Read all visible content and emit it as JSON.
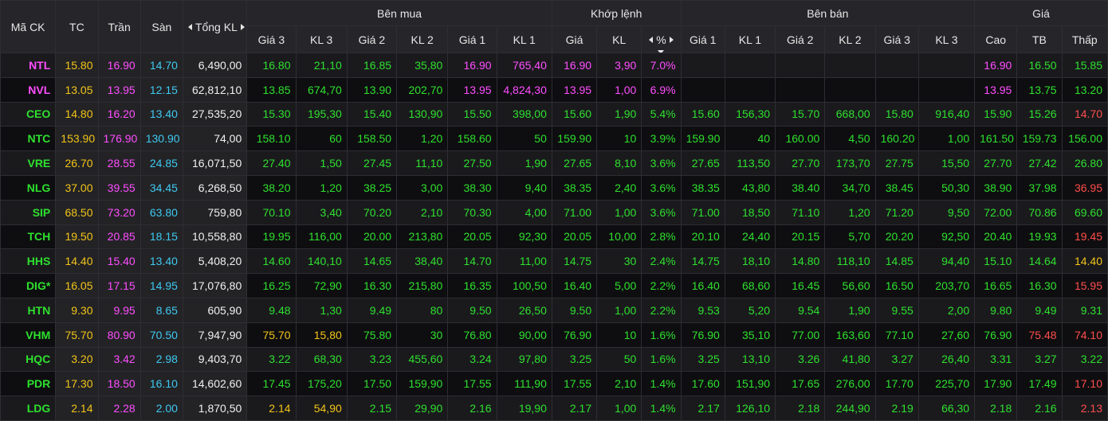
{
  "header": {
    "symbol": "Mã CK",
    "ref": "TC",
    "ceil": "Trần",
    "floor": "Sàn",
    "total_vol": "Tổng KL",
    "buy_group": "Bên mua",
    "match_group": "Khớp lệnh",
    "sell_group": "Bên bán",
    "price_group": "Giá",
    "buy_cols": [
      "Giá 3",
      "KL 3",
      "Giá 2",
      "KL 2",
      "Giá 1",
      "KL 1"
    ],
    "match_cols": [
      "Giá",
      "KL",
      "%"
    ],
    "sell_cols": [
      "Giá 1",
      "KL 1",
      "Giá 2",
      "KL 2",
      "Giá 3",
      "KL 3"
    ],
    "price_cols": [
      "Cao",
      "TB",
      "Thấp"
    ]
  },
  "colors": {
    "ceil": "#ff4dff",
    "floor": "#3fc9f0",
    "ref": "#f2c418",
    "up": "#2ee02e",
    "down": "#ff4d4d"
  },
  "rows": [
    {
      "sym": "NTL",
      "sc": "ceil",
      "tc": "15.80",
      "ceil": "16.90",
      "floor": "14.70",
      "tot": "6,490,00",
      "b": [
        [
          "16.80",
          "up"
        ],
        [
          "21,10",
          "up"
        ],
        [
          "16.85",
          "up"
        ],
        [
          "35,80",
          "up"
        ],
        [
          "16.90",
          "ceil"
        ],
        [
          "765,40",
          "ceil"
        ]
      ],
      "m": [
        [
          "16.90",
          "ceil"
        ],
        [
          "3,90",
          "ceil"
        ],
        [
          "7.0%",
          "ceil"
        ]
      ],
      "s": [
        [
          "",
          ""
        ],
        [
          "",
          ""
        ],
        [
          "",
          ""
        ],
        [
          "",
          ""
        ],
        [
          "",
          ""
        ],
        [
          "",
          ""
        ]
      ],
      "p": [
        [
          "16.90",
          "ceil"
        ],
        [
          "16.50",
          "up"
        ],
        [
          "15.85",
          "up"
        ]
      ]
    },
    {
      "sym": "NVL",
      "sc": "ceil",
      "tc": "13.05",
      "ceil": "13.95",
      "floor": "12.15",
      "tot": "62,812,10",
      "b": [
        [
          "13.85",
          "up"
        ],
        [
          "674,70",
          "up"
        ],
        [
          "13.90",
          "up"
        ],
        [
          "202,70",
          "up"
        ],
        [
          "13.95",
          "ceil"
        ],
        [
          "4,824,30",
          "ceil"
        ]
      ],
      "m": [
        [
          "13.95",
          "ceil"
        ],
        [
          "1,00",
          "ceil"
        ],
        [
          "6.9%",
          "ceil"
        ]
      ],
      "s": [
        [
          "",
          ""
        ],
        [
          "",
          ""
        ],
        [
          "",
          ""
        ],
        [
          "",
          ""
        ],
        [
          "",
          ""
        ],
        [
          "",
          ""
        ]
      ],
      "p": [
        [
          "13.95",
          "ceil"
        ],
        [
          "13.75",
          "up"
        ],
        [
          "13.20",
          "up"
        ]
      ]
    },
    {
      "sym": "CEO",
      "sc": "up",
      "tc": "14.80",
      "ceil": "16.20",
      "floor": "13.40",
      "tot": "27,535,20",
      "b": [
        [
          "15.30",
          "up"
        ],
        [
          "195,30",
          "up"
        ],
        [
          "15.40",
          "up"
        ],
        [
          "130,90",
          "up"
        ],
        [
          "15.50",
          "up"
        ],
        [
          "398,00",
          "up"
        ]
      ],
      "m": [
        [
          "15.60",
          "up"
        ],
        [
          "1,90",
          "up"
        ],
        [
          "5.4%",
          "up"
        ]
      ],
      "s": [
        [
          "15.60",
          "up"
        ],
        [
          "156,30",
          "up"
        ],
        [
          "15.70",
          "up"
        ],
        [
          "668,00",
          "up"
        ],
        [
          "15.80",
          "up"
        ],
        [
          "916,40",
          "up"
        ]
      ],
      "p": [
        [
          "15.90",
          "up"
        ],
        [
          "15.26",
          "up"
        ],
        [
          "14.70",
          "down"
        ]
      ]
    },
    {
      "sym": "NTC",
      "sc": "up",
      "tc": "153.90",
      "ceil": "176.90",
      "floor": "130.90",
      "tot": "74,00",
      "b": [
        [
          "158.10",
          "up"
        ],
        [
          "60",
          "up"
        ],
        [
          "158.50",
          "up"
        ],
        [
          "1,20",
          "up"
        ],
        [
          "158.60",
          "up"
        ],
        [
          "50",
          "up"
        ]
      ],
      "m": [
        [
          "159.90",
          "up"
        ],
        [
          "10",
          "up"
        ],
        [
          "3.9%",
          "up"
        ]
      ],
      "s": [
        [
          "159.90",
          "up"
        ],
        [
          "40",
          "up"
        ],
        [
          "160.00",
          "up"
        ],
        [
          "4,50",
          "up"
        ],
        [
          "160.20",
          "up"
        ],
        [
          "1,00",
          "up"
        ]
      ],
      "p": [
        [
          "161.50",
          "up"
        ],
        [
          "159.73",
          "up"
        ],
        [
          "156.00",
          "up"
        ]
      ]
    },
    {
      "sym": "VRE",
      "sc": "up",
      "tc": "26.70",
      "ceil": "28.55",
      "floor": "24.85",
      "tot": "16,071,50",
      "b": [
        [
          "27.40",
          "up"
        ],
        [
          "1,50",
          "up"
        ],
        [
          "27.45",
          "up"
        ],
        [
          "11,10",
          "up"
        ],
        [
          "27.50",
          "up"
        ],
        [
          "1,90",
          "up"
        ]
      ],
      "m": [
        [
          "27.65",
          "up"
        ],
        [
          "8,10",
          "up"
        ],
        [
          "3.6%",
          "up"
        ]
      ],
      "s": [
        [
          "27.65",
          "up"
        ],
        [
          "113,50",
          "up"
        ],
        [
          "27.70",
          "up"
        ],
        [
          "173,70",
          "up"
        ],
        [
          "27.75",
          "up"
        ],
        [
          "15,50",
          "up"
        ]
      ],
      "p": [
        [
          "27.70",
          "up"
        ],
        [
          "27.42",
          "up"
        ],
        [
          "26.80",
          "up"
        ]
      ]
    },
    {
      "sym": "NLG",
      "sc": "up",
      "tc": "37.00",
      "ceil": "39.55",
      "floor": "34.45",
      "tot": "6,268,50",
      "b": [
        [
          "38.20",
          "up"
        ],
        [
          "1,20",
          "up"
        ],
        [
          "38.25",
          "up"
        ],
        [
          "3,00",
          "up"
        ],
        [
          "38.30",
          "up"
        ],
        [
          "9,40",
          "up"
        ]
      ],
      "m": [
        [
          "38.35",
          "up"
        ],
        [
          "2,40",
          "up"
        ],
        [
          "3.6%",
          "up"
        ]
      ],
      "s": [
        [
          "38.35",
          "up"
        ],
        [
          "43,80",
          "up"
        ],
        [
          "38.40",
          "up"
        ],
        [
          "34,70",
          "up"
        ],
        [
          "38.45",
          "up"
        ],
        [
          "50,30",
          "up"
        ]
      ],
      "p": [
        [
          "38.90",
          "up"
        ],
        [
          "37.98",
          "up"
        ],
        [
          "36.95",
          "down"
        ]
      ]
    },
    {
      "sym": "SIP",
      "sc": "up",
      "tc": "68.50",
      "ceil": "73.20",
      "floor": "63.80",
      "tot": "759,80",
      "b": [
        [
          "70.10",
          "up"
        ],
        [
          "3,40",
          "up"
        ],
        [
          "70.20",
          "up"
        ],
        [
          "2,10",
          "up"
        ],
        [
          "70.30",
          "up"
        ],
        [
          "4,00",
          "up"
        ]
      ],
      "m": [
        [
          "71.00",
          "up"
        ],
        [
          "1,00",
          "up"
        ],
        [
          "3.6%",
          "up"
        ]
      ],
      "s": [
        [
          "71.00",
          "up"
        ],
        [
          "18,50",
          "up"
        ],
        [
          "71.10",
          "up"
        ],
        [
          "1,20",
          "up"
        ],
        [
          "71.20",
          "up"
        ],
        [
          "9,50",
          "up"
        ]
      ],
      "p": [
        [
          "72.00",
          "up"
        ],
        [
          "70.86",
          "up"
        ],
        [
          "69.60",
          "up"
        ]
      ]
    },
    {
      "sym": "TCH",
      "sc": "up",
      "tc": "19.50",
      "ceil": "20.85",
      "floor": "18.15",
      "tot": "10,558,80",
      "b": [
        [
          "19.95",
          "up"
        ],
        [
          "116,00",
          "up"
        ],
        [
          "20.00",
          "up"
        ],
        [
          "213,80",
          "up"
        ],
        [
          "20.05",
          "up"
        ],
        [
          "92,30",
          "up"
        ]
      ],
      "m": [
        [
          "20.05",
          "up"
        ],
        [
          "10,00",
          "up"
        ],
        [
          "2.8%",
          "up"
        ]
      ],
      "s": [
        [
          "20.10",
          "up"
        ],
        [
          "24,40",
          "up"
        ],
        [
          "20.15",
          "up"
        ],
        [
          "5,70",
          "up"
        ],
        [
          "20.20",
          "up"
        ],
        [
          "92,50",
          "up"
        ]
      ],
      "p": [
        [
          "20.40",
          "up"
        ],
        [
          "19.93",
          "up"
        ],
        [
          "19.45",
          "down"
        ]
      ]
    },
    {
      "sym": "HHS",
      "sc": "up",
      "tc": "14.40",
      "ceil": "15.40",
      "floor": "13.40",
      "tot": "5,408,20",
      "b": [
        [
          "14.60",
          "up"
        ],
        [
          "140,10",
          "up"
        ],
        [
          "14.65",
          "up"
        ],
        [
          "38,40",
          "up"
        ],
        [
          "14.70",
          "up"
        ],
        [
          "11,00",
          "up"
        ]
      ],
      "m": [
        [
          "14.75",
          "up"
        ],
        [
          "30",
          "up"
        ],
        [
          "2.4%",
          "up"
        ]
      ],
      "s": [
        [
          "14.75",
          "up"
        ],
        [
          "18,10",
          "up"
        ],
        [
          "14.80",
          "up"
        ],
        [
          "118,10",
          "up"
        ],
        [
          "14.85",
          "up"
        ],
        [
          "94,40",
          "up"
        ]
      ],
      "p": [
        [
          "15.10",
          "up"
        ],
        [
          "14.64",
          "up"
        ],
        [
          "14.40",
          "ref"
        ]
      ]
    },
    {
      "sym": "DIG*",
      "sc": "up",
      "tc": "16.05",
      "ceil": "17.15",
      "floor": "14.95",
      "tot": "17,076,80",
      "b": [
        [
          "16.25",
          "up"
        ],
        [
          "72,90",
          "up"
        ],
        [
          "16.30",
          "up"
        ],
        [
          "215,80",
          "up"
        ],
        [
          "16.35",
          "up"
        ],
        [
          "100,50",
          "up"
        ]
      ],
      "m": [
        [
          "16.40",
          "up"
        ],
        [
          "5,00",
          "up"
        ],
        [
          "2.2%",
          "up"
        ]
      ],
      "s": [
        [
          "16.40",
          "up"
        ],
        [
          "68,60",
          "up"
        ],
        [
          "16.45",
          "up"
        ],
        [
          "56,60",
          "up"
        ],
        [
          "16.50",
          "up"
        ],
        [
          "203,70",
          "up"
        ]
      ],
      "p": [
        [
          "16.65",
          "up"
        ],
        [
          "16.30",
          "up"
        ],
        [
          "15.95",
          "down"
        ]
      ]
    },
    {
      "sym": "HTN",
      "sc": "up",
      "tc": "9.30",
      "ceil": "9.95",
      "floor": "8.65",
      "tot": "605,90",
      "b": [
        [
          "9.48",
          "up"
        ],
        [
          "1,30",
          "up"
        ],
        [
          "9.49",
          "up"
        ],
        [
          "80",
          "up"
        ],
        [
          "9.50",
          "up"
        ],
        [
          "26,50",
          "up"
        ]
      ],
      "m": [
        [
          "9.50",
          "up"
        ],
        [
          "1,00",
          "up"
        ],
        [
          "2.2%",
          "up"
        ]
      ],
      "s": [
        [
          "9.53",
          "up"
        ],
        [
          "5,20",
          "up"
        ],
        [
          "9.54",
          "up"
        ],
        [
          "1,90",
          "up"
        ],
        [
          "9.55",
          "up"
        ],
        [
          "2,00",
          "up"
        ]
      ],
      "p": [
        [
          "9.80",
          "up"
        ],
        [
          "9.49",
          "up"
        ],
        [
          "9.31",
          "up"
        ]
      ]
    },
    {
      "sym": "VHM",
      "sc": "up",
      "tc": "75.70",
      "ceil": "80.90",
      "floor": "70.50",
      "tot": "7,947,90",
      "b": [
        [
          "75.70",
          "ref"
        ],
        [
          "15,80",
          "ref"
        ],
        [
          "75.80",
          "up"
        ],
        [
          "30",
          "up"
        ],
        [
          "76.80",
          "up"
        ],
        [
          "90,00",
          "up"
        ]
      ],
      "m": [
        [
          "76.90",
          "up"
        ],
        [
          "10",
          "up"
        ],
        [
          "1.6%",
          "up"
        ]
      ],
      "s": [
        [
          "76.90",
          "up"
        ],
        [
          "35,10",
          "up"
        ],
        [
          "77.00",
          "up"
        ],
        [
          "163,60",
          "up"
        ],
        [
          "77.10",
          "up"
        ],
        [
          "27,60",
          "up"
        ]
      ],
      "p": [
        [
          "76.90",
          "up"
        ],
        [
          "75.48",
          "down"
        ],
        [
          "74.10",
          "down"
        ]
      ]
    },
    {
      "sym": "HQC",
      "sc": "up",
      "tc": "3.20",
      "ceil": "3.42",
      "floor": "2.98",
      "tot": "9,403,70",
      "b": [
        [
          "3.22",
          "up"
        ],
        [
          "68,30",
          "up"
        ],
        [
          "3.23",
          "up"
        ],
        [
          "455,60",
          "up"
        ],
        [
          "3.24",
          "up"
        ],
        [
          "97,80",
          "up"
        ]
      ],
      "m": [
        [
          "3.25",
          "up"
        ],
        [
          "50",
          "up"
        ],
        [
          "1.6%",
          "up"
        ]
      ],
      "s": [
        [
          "3.25",
          "up"
        ],
        [
          "13,10",
          "up"
        ],
        [
          "3.26",
          "up"
        ],
        [
          "41,80",
          "up"
        ],
        [
          "3.27",
          "up"
        ],
        [
          "26,40",
          "up"
        ]
      ],
      "p": [
        [
          "3.31",
          "up"
        ],
        [
          "3.27",
          "up"
        ],
        [
          "3.22",
          "up"
        ]
      ]
    },
    {
      "sym": "PDR",
      "sc": "up",
      "tc": "17.30",
      "ceil": "18.50",
      "floor": "16.10",
      "tot": "14,602,60",
      "b": [
        [
          "17.45",
          "up"
        ],
        [
          "175,20",
          "up"
        ],
        [
          "17.50",
          "up"
        ],
        [
          "159,90",
          "up"
        ],
        [
          "17.55",
          "up"
        ],
        [
          "111,90",
          "up"
        ]
      ],
      "m": [
        [
          "17.55",
          "up"
        ],
        [
          "2,10",
          "up"
        ],
        [
          "1.4%",
          "up"
        ]
      ],
      "s": [
        [
          "17.60",
          "up"
        ],
        [
          "151,90",
          "up"
        ],
        [
          "17.65",
          "up"
        ],
        [
          "276,00",
          "up"
        ],
        [
          "17.70",
          "up"
        ],
        [
          "225,70",
          "up"
        ]
      ],
      "p": [
        [
          "17.90",
          "up"
        ],
        [
          "17.49",
          "up"
        ],
        [
          "17.10",
          "down"
        ]
      ]
    },
    {
      "sym": "LDG",
      "sc": "up",
      "tc": "2.14",
      "ceil": "2.28",
      "floor": "2.00",
      "tot": "1,870,50",
      "b": [
        [
          "2.14",
          "ref"
        ],
        [
          "54,90",
          "ref"
        ],
        [
          "2.15",
          "up"
        ],
        [
          "29,90",
          "up"
        ],
        [
          "2.16",
          "up"
        ],
        [
          "19,90",
          "up"
        ]
      ],
      "m": [
        [
          "2.17",
          "up"
        ],
        [
          "1,00",
          "up"
        ],
        [
          "1.4%",
          "up"
        ]
      ],
      "s": [
        [
          "2.17",
          "up"
        ],
        [
          "126,10",
          "up"
        ],
        [
          "2.18",
          "up"
        ],
        [
          "244,90",
          "up"
        ],
        [
          "2.19",
          "up"
        ],
        [
          "66,30",
          "up"
        ]
      ],
      "p": [
        [
          "2.18",
          "up"
        ],
        [
          "2.16",
          "up"
        ],
        [
          "2.13",
          "down"
        ]
      ]
    }
  ]
}
